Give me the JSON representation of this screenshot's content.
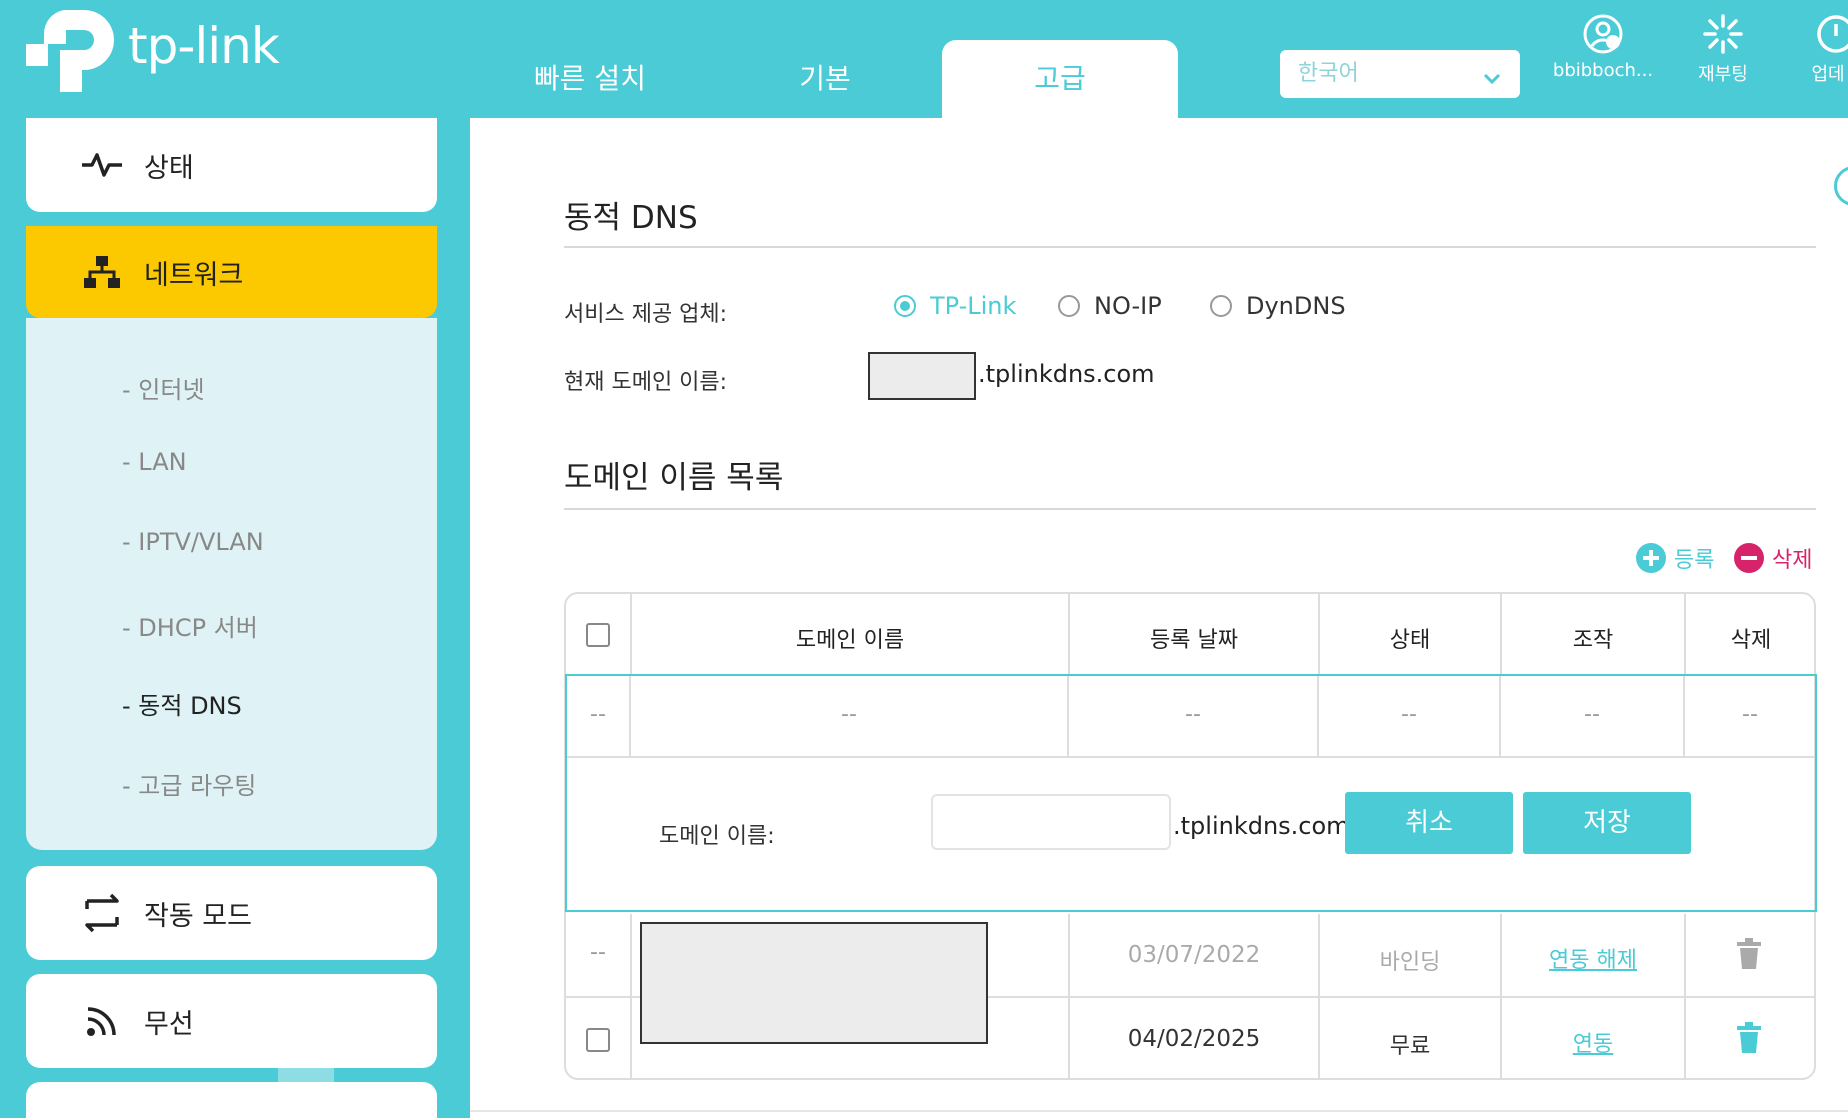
{
  "brand": {
    "logo_text": "tp-link"
  },
  "tabs": [
    {
      "label": "빠른 설치"
    },
    {
      "label": "기본"
    },
    {
      "label": "고급"
    }
  ],
  "language": {
    "selected": "한국어"
  },
  "tools": {
    "account": "bbibboch...",
    "reboot": "재부팅",
    "update": "업데"
  },
  "sidebar": {
    "status": "상태",
    "network": "네트워크",
    "sub_items": [
      "- 인터넷",
      "- LAN",
      "- IPTV/VLAN",
      "- DHCP 서버",
      "- 동적 DNS",
      "- 고급 라우팅"
    ],
    "operation_mode": "작동 모드",
    "wireless": "무선"
  },
  "ddns": {
    "title": "동적 DNS",
    "provider_label": "서비스 제공 업체:",
    "providers": [
      "TP-Link",
      "NO-IP",
      "DynDNS"
    ],
    "selected_provider": "TP-Link",
    "current_domain_label": "현재 도메인 이름:",
    "domain_suffix": ".tplinkdns.com"
  },
  "domain_list": {
    "title": "도메인 이름 목록",
    "add_label": "등록",
    "delete_label": "삭제",
    "columns": [
      "도메인 이름",
      "등록 날짜",
      "상태",
      "조작",
      "삭제"
    ],
    "placeholder_row": [
      "--",
      "--",
      "--",
      "--",
      "--",
      "--"
    ],
    "edit": {
      "label": "도메인 이름:",
      "suffix": ".tplinkdns.com",
      "cancel": "취소",
      "save": "저장"
    },
    "rows": [
      {
        "check": "--",
        "date": "03/07/2022",
        "status": "바인딩",
        "action": "연동 해제"
      },
      {
        "date": "04/02/2025",
        "status": "무료",
        "action": "연동"
      }
    ]
  },
  "colors": {
    "accent": "#4acbd6",
    "highlight": "#fcc800",
    "delete": "#d6236a",
    "subpanel": "#dff3f6"
  }
}
